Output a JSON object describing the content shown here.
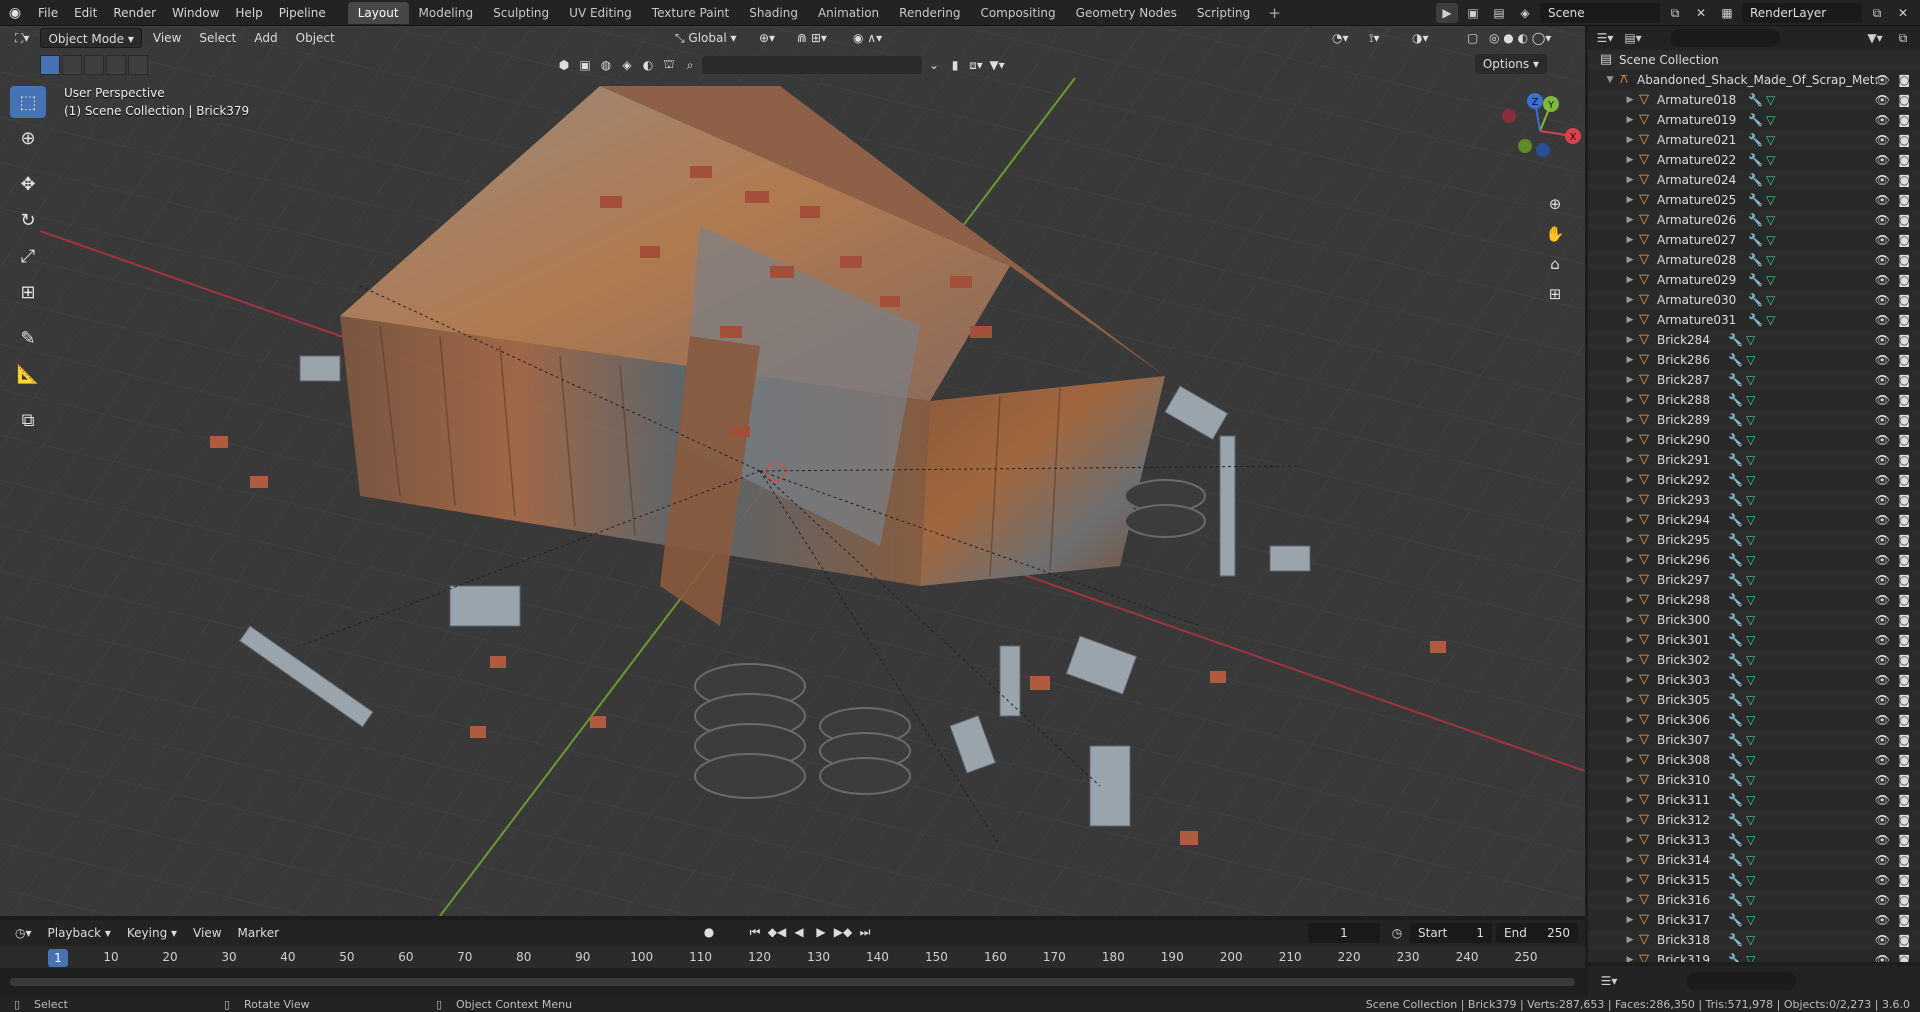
{
  "topbar": {
    "menus": [
      "File",
      "Edit",
      "Render",
      "Window",
      "Help",
      "Pipeline"
    ],
    "workspaces": [
      "Layout",
      "Modeling",
      "Sculpting",
      "UV Editing",
      "Texture Paint",
      "Shading",
      "Animation",
      "Rendering",
      "Compositing",
      "Geometry Nodes",
      "Scripting"
    ],
    "active_workspace": "Layout",
    "scene": "Scene",
    "view_layer": "RenderLayer"
  },
  "viewport": {
    "mode": "Object Mode",
    "menus": [
      "View",
      "Select",
      "Add",
      "Object"
    ],
    "transform_orientation": "Global",
    "options_label": "Options",
    "info_line1": "User Perspective",
    "info_line2": "(1) Scene Collection | Brick379",
    "gizmo_axes": [
      "Z",
      "Y",
      "X"
    ]
  },
  "outliner": {
    "root": "Scene Collection",
    "collection": "Abandoned_Shack_Made_Of_Scrap_Met:",
    "items": [
      "Armature018",
      "Armature019",
      "Armature021",
      "Armature022",
      "Armature024",
      "Armature025",
      "Armature026",
      "Armature027",
      "Armature028",
      "Armature029",
      "Armature030",
      "Armature031",
      "Brick284",
      "Brick286",
      "Brick287",
      "Brick288",
      "Brick289",
      "Brick290",
      "Brick291",
      "Brick292",
      "Brick293",
      "Brick294",
      "Brick295",
      "Brick296",
      "Brick297",
      "Brick298",
      "Brick300",
      "Brick301",
      "Brick302",
      "Brick303",
      "Brick305",
      "Brick306",
      "Brick307",
      "Brick308",
      "Brick310",
      "Brick311",
      "Brick312",
      "Brick313",
      "Brick314",
      "Brick315",
      "Brick316",
      "Brick317",
      "Brick318",
      "Brick319"
    ]
  },
  "timeline": {
    "menus": [
      "Playback",
      "Keying",
      "View",
      "Marker"
    ],
    "current_frame": "1",
    "start_label": "Start",
    "start": "1",
    "end_label": "End",
    "end": "250",
    "ruler": [
      "1",
      "10",
      "20",
      "30",
      "40",
      "50",
      "60",
      "70",
      "80",
      "90",
      "100",
      "110",
      "120",
      "130",
      "140",
      "150",
      "160",
      "170",
      "180",
      "190",
      "200",
      "210",
      "220",
      "230",
      "240",
      "250"
    ]
  },
  "statusbar": {
    "select": "Select",
    "rotate": "Rotate View",
    "context": "Object Context Menu",
    "stats": "Scene Collection | Brick379 | Verts:287,653 | Faces:286,350 | Tris:571,978 | Objects:0/2,273 | 3.6.0"
  },
  "colors": {
    "accent": "#4772b3",
    "object_icon": "#e8a04a",
    "mesh_icon": "#3fcf86",
    "x_axis": "#d8424f",
    "y_axis": "#7fb83a"
  }
}
